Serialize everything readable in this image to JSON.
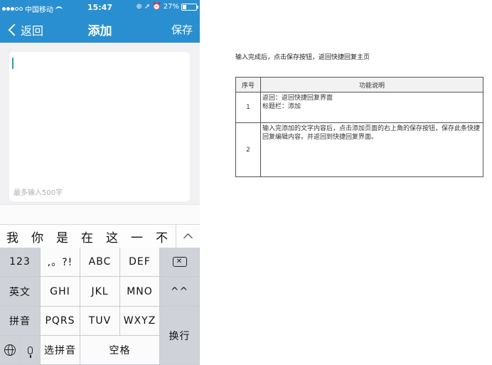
{
  "status_bar": {
    "carrier": "中国移动",
    "time": "15:47",
    "battery": "27%",
    "battery_level": 0.27
  },
  "nav": {
    "back_label": "返回",
    "title": "添加",
    "save_label": "保存"
  },
  "editor": {
    "value": "",
    "limit_hint": "最多输入500字"
  },
  "candidates": [
    "我",
    "你",
    "是",
    "在",
    "这",
    "一",
    "不"
  ],
  "keyboard": {
    "key_123": "123",
    "key_punct": ",。?!",
    "key_abc": "ABC",
    "key_def": "DEF",
    "key_en": "英文",
    "key_ghi": "GHI",
    "key_jkl": "JKL",
    "key_mno": "MNO",
    "key_emoticon": "^^",
    "key_pinyin": "拼音",
    "key_pqrs": "PQRS",
    "key_tuv": "TUV",
    "key_wxyz": "WXYZ",
    "key_return": "换行",
    "key_select_pinyin": "选拼音",
    "key_space": "空格"
  },
  "doc": {
    "description": "输入完成后，点击保存按钮，返回快捷回复主页",
    "table": {
      "headers": [
        "序号",
        "功能说明"
      ],
      "rows": [
        {
          "num": "1",
          "lines": [
            "返回：返回快捷回复界面",
            "标题栏：添加"
          ]
        },
        {
          "num": "2",
          "lines": [
            "输入完添加的文字内容后，点击添加页面的右上角的保存按钮，保存此条快捷回复编辑内容。并返回到快捷回复界面。"
          ]
        }
      ]
    }
  }
}
